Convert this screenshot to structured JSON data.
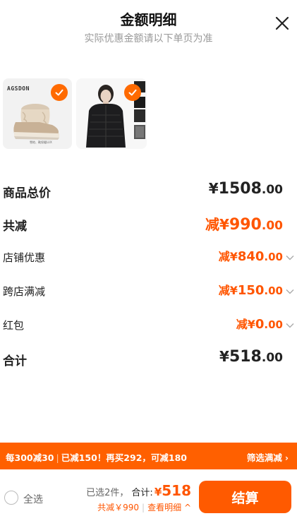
{
  "header": {
    "title": "金额明细",
    "subtitle": "实际优惠金额请以下单页为准",
    "close_icon": "close-icon"
  },
  "products": [
    {
      "brand": "AGSDON",
      "caption": "雪地、靴保暖LUX",
      "checked": true,
      "image": "snow-boot-image"
    },
    {
      "checked": true,
      "image": "black-puffer-jacket-model-image"
    }
  ],
  "price_rows": {
    "total": {
      "label": "商品总价",
      "prefix": "¥",
      "int": "1508",
      "dec": ".00"
    },
    "discount_total": {
      "label": "共减",
      "prefix": "减¥",
      "int": "990",
      "dec": ".00"
    },
    "shop_discount": {
      "label": "店铺优惠",
      "prefix": "减¥",
      "int": "840",
      "dec": ".00"
    },
    "cross_store": {
      "label": "跨店满减",
      "prefix": "减¥",
      "int": "150",
      "dec": ".00"
    },
    "red_packet": {
      "label": "红包",
      "prefix": "减¥",
      "int": "0",
      "dec": ".00"
    },
    "sum": {
      "label": "合计",
      "prefix": "¥",
      "int": "518",
      "dec": ".00"
    }
  },
  "promo": {
    "part1": "每300减30",
    "part2": "已减150！再买292，可减180",
    "link": "筛选满减",
    "arrow": "›"
  },
  "bottom_bar": {
    "select_all": "全选",
    "selected_count": "已选2件，",
    "total_label": "合计:",
    "total_yen": "¥",
    "total_value": "518",
    "discount_text": "共减￥990",
    "detail_link": "查看明细",
    "detail_arrow": "^",
    "checkout": "结算"
  },
  "colors": {
    "accent": "#ff5500",
    "promo_bg": "#ff6000",
    "checkout_bg": "#ff5a00"
  }
}
